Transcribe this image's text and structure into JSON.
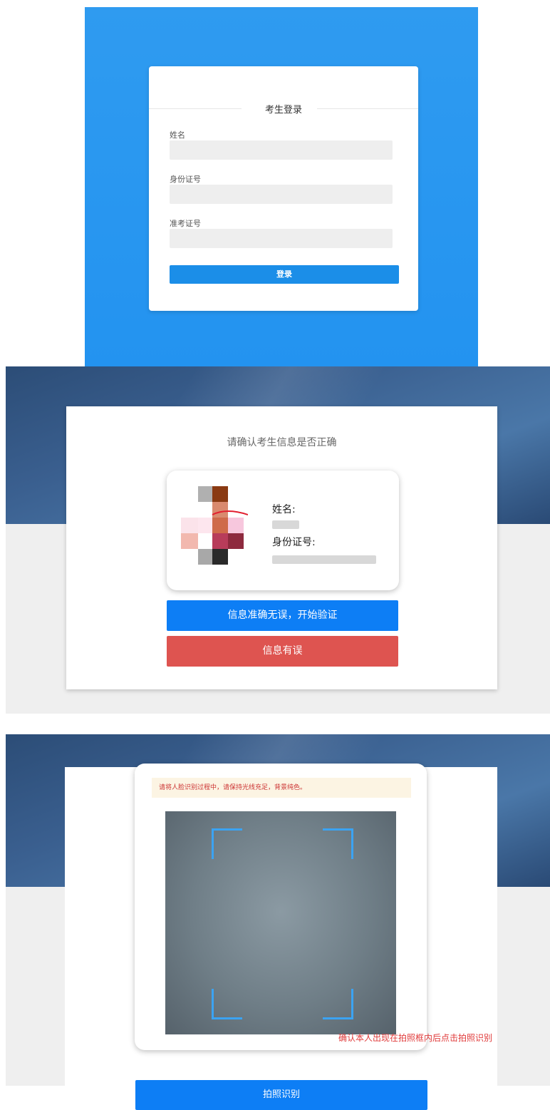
{
  "login": {
    "title": "考生登录",
    "fields": [
      {
        "label": "姓名",
        "value": ""
      },
      {
        "label": "身份证号",
        "value": ""
      },
      {
        "label": "准考证号",
        "value": ""
      }
    ],
    "submit_label": "登录"
  },
  "confirm": {
    "title": "请确认考生信息是否正确",
    "name_label": "姓名:",
    "id_label": "身份证号:",
    "ok_label": "信息准确无误，开始验证",
    "error_label": "信息有误"
  },
  "capture": {
    "notice": "请将人脸识别过程中，请保持光线充足，背景纯色。",
    "hint": "确认本人出现在拍照框内后点击拍照识别",
    "shoot_label": "拍照识别"
  },
  "colors": {
    "login_bg": "#2393f0",
    "primary_button": "#0d7ef5",
    "danger_button": "#de5450",
    "frame_corner": "#3ba3f2",
    "hint_text": "#e03a3a"
  }
}
